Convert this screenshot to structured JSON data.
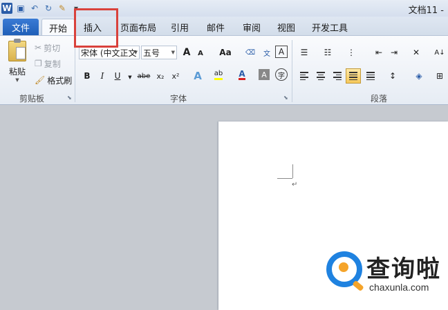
{
  "window": {
    "title": "文档11 -"
  },
  "quick_access": {
    "icons": [
      "word-icon",
      "save-icon",
      "undo-icon",
      "redo-icon",
      "format-painter-icon",
      "customize-icon"
    ]
  },
  "tabs": [
    {
      "label": "文件"
    },
    {
      "label": "开始"
    },
    {
      "label": "插入"
    },
    {
      "label": "页面布局"
    },
    {
      "label": "引用"
    },
    {
      "label": "邮件"
    },
    {
      "label": "审阅"
    },
    {
      "label": "视图"
    },
    {
      "label": "开发工具"
    }
  ],
  "clipboard": {
    "paste_label": "粘贴",
    "cut_label": "剪切",
    "copy_label": "复制",
    "format_painter_label": "格式刷",
    "group_label": "剪贴板"
  },
  "font": {
    "font_name": "宋体 (中文正文",
    "font_size": "五号",
    "grow_label": "A",
    "shrink_label": "A",
    "case_label": "Aa",
    "bold": "B",
    "italic": "I",
    "underline": "U",
    "strike": "abe",
    "subscript": "x₂",
    "superscript": "x²",
    "group_label": "字体"
  },
  "paragraph": {
    "group_label": "段落"
  },
  "document": {
    "paragraph_mark": "↵"
  },
  "watermark": {
    "cn_text": "查询啦",
    "en_text": "chaxunla.com"
  },
  "colors": {
    "file_tab": "#2a68c4",
    "highlight_box": "#d9413b",
    "font_color": "#d82020",
    "highlight_color": "#ffff00"
  }
}
